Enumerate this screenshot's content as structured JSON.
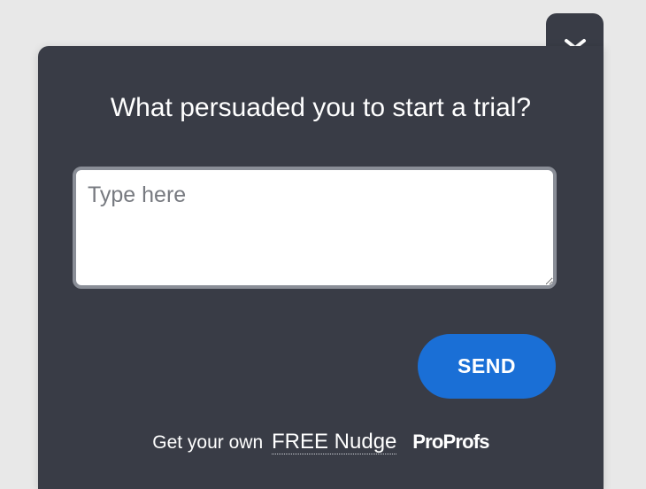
{
  "widget": {
    "question": "What persuaded you to start a trial?",
    "input_placeholder": "Type here",
    "input_value": "",
    "send_label": "SEND",
    "collapse_icon": "chevron-down-icon"
  },
  "footer": {
    "prefix": "Get your own",
    "link_text": "FREE Nudge",
    "brand": "ProProfs"
  },
  "colors": {
    "background": "#e8e8e8",
    "panel": "#393c46",
    "accent": "#1a6fd6",
    "text": "#ffffff"
  }
}
